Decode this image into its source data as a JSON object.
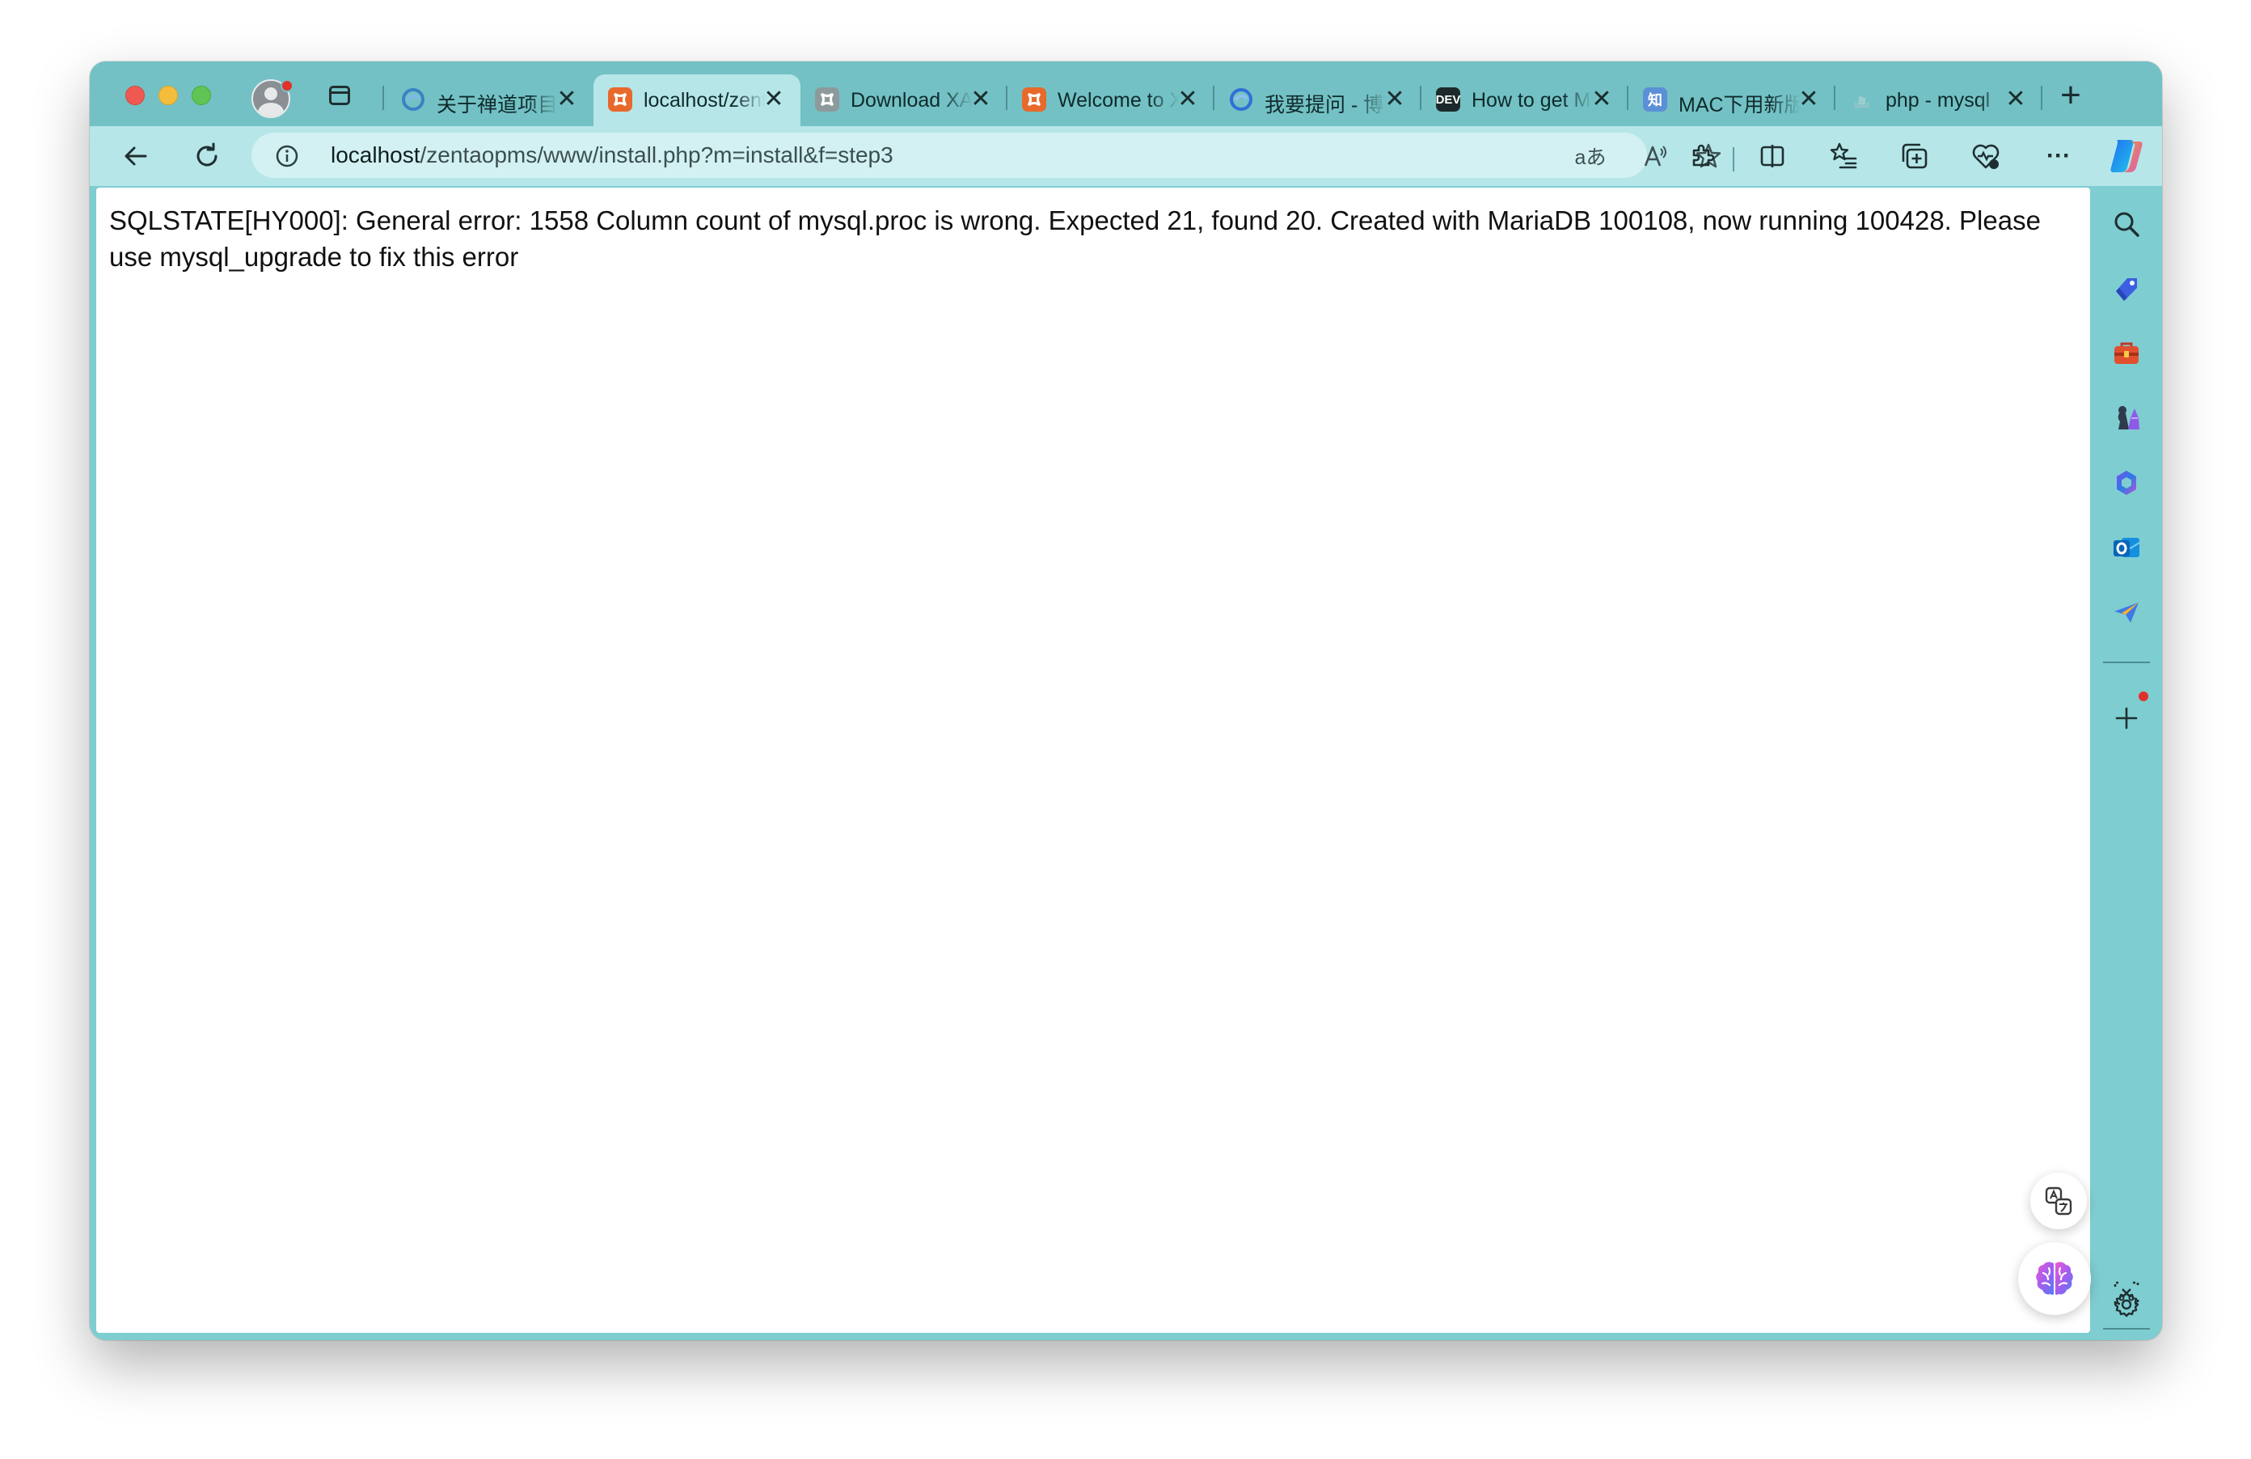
{
  "window": {
    "tabs": [
      {
        "title": "关于禅道项目管理软件安装",
        "icon": "edge-icon",
        "icon_color": "#3b82c4",
        "active": false
      },
      {
        "title": "localhost/zentaopms",
        "icon": "xampp-icon",
        "icon_color": "#e8692c",
        "active": true
      },
      {
        "title": "Download XAMPP",
        "icon": "xampp-icon",
        "icon_color": "#8d9a9c",
        "active": false
      },
      {
        "title": "Welcome to XAMPP",
        "icon": "xampp-icon",
        "icon_color": "#e8692c",
        "active": false
      },
      {
        "title": "我要提问 - 博客",
        "icon": "edge-icon",
        "icon_color": "#2f6fd8",
        "active": false
      },
      {
        "title": "How to get MySQL",
        "icon": "dev-icon",
        "icon_color": "#1d2a2c",
        "icon_text": "DEV",
        "active": false
      },
      {
        "title": "MAC下用新版本",
        "icon": "zhihu-icon",
        "icon_color": "#5b8fd8",
        "icon_text": "知",
        "active": false
      },
      {
        "title": "php - mysql",
        "icon": "stackoverflow-icon",
        "icon_color": "#8fc4c7",
        "active": false
      }
    ],
    "close_glyph": "✕",
    "new_tab_glyph": "+"
  },
  "toolbar": {
    "url_host": "localhost",
    "url_path": "/zentaopms/www/install.php?m=install&f=step3",
    "translate_glyph": "aあ",
    "read_aloud_glyph": "A",
    "more_glyph": "···"
  },
  "page": {
    "error_message": "SQLSTATE[HY000]: General error: 1558 Column count of mysql.proc is wrong. Expected 21, found 20. Created with MariaDB 100108, now running 100428. Please use mysql_upgrade to fix this error"
  },
  "colors": {
    "frame": "#7ecdd1",
    "tabstrip": "#73c1c4",
    "toolbar": "#b6e6e8",
    "omnibox": "#d3f1f2",
    "content": "#ffffff"
  }
}
